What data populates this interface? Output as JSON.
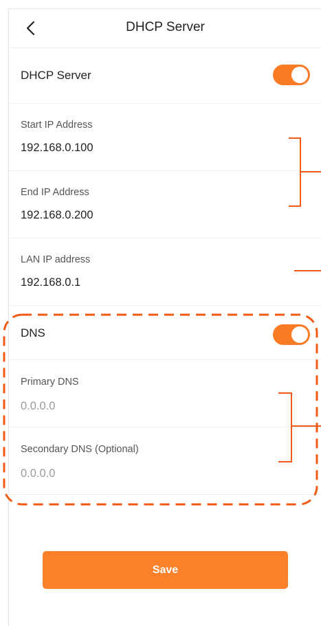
{
  "header": {
    "title": "DHCP Server"
  },
  "dhcp": {
    "label": "DHCP Server",
    "enabled": true
  },
  "fields": {
    "start_ip": {
      "label": "Start IP Address",
      "value": "192.168.0.100"
    },
    "end_ip": {
      "label": "End IP Address",
      "value": "192.168.0.200"
    },
    "lan_ip": {
      "label": "LAN IP address",
      "value": "192.168.0.1"
    }
  },
  "dns": {
    "label": "DNS",
    "enabled": true,
    "primary": {
      "label": "Primary DNS",
      "placeholder": "0.0.0.0"
    },
    "secondary": {
      "label": "Secondary DNS (Optional)",
      "placeholder": "0.0.0.0"
    }
  },
  "actions": {
    "save_label": "Save"
  },
  "colors": {
    "accent": "#fa7b26",
    "annotation": "#f05a12"
  },
  "icons": {
    "back": "chevron-left-icon"
  }
}
